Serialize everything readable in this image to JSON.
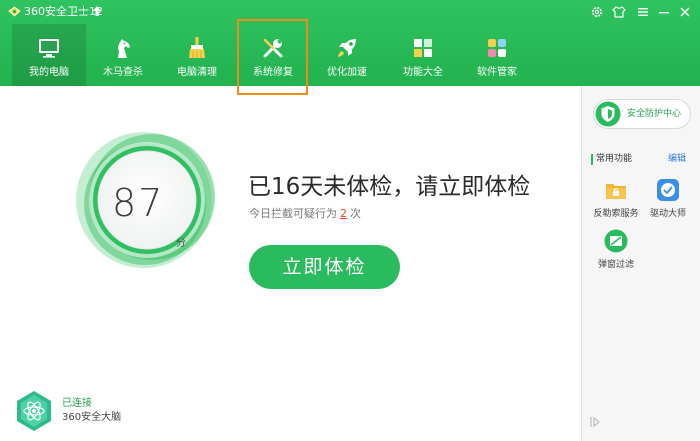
{
  "app": {
    "title": "360安全卫士12"
  },
  "nav": {
    "items": [
      {
        "label": "我的电脑"
      },
      {
        "label": "木马查杀"
      },
      {
        "label": "电脑清理"
      },
      {
        "label": "系统修复"
      },
      {
        "label": "优化加速"
      },
      {
        "label": "功能大全"
      },
      {
        "label": "软件管家"
      }
    ]
  },
  "main": {
    "score": "87",
    "score_unit": "分",
    "headline": "已16天未体检，请立即体检",
    "sub_prefix": "今日拦截可疑行为",
    "sub_count": "2",
    "sub_suffix": "次",
    "check_button": "立即体检"
  },
  "brain": {
    "status": "已连接",
    "name": "360安全大脑"
  },
  "right_panel": {
    "security_center": "安全防护中心",
    "section_title": "常用功能",
    "edit": "编辑",
    "tools": [
      {
        "label": "反勒索服务"
      },
      {
        "label": "驱动大师"
      },
      {
        "label": "弹窗过滤"
      }
    ]
  },
  "colors": {
    "header_green": "#22b24f",
    "button_green": "#2bbb5f",
    "highlight_orange": "#f08a1c",
    "count_red": "#e8412b",
    "link_blue": "#2f7de1"
  }
}
